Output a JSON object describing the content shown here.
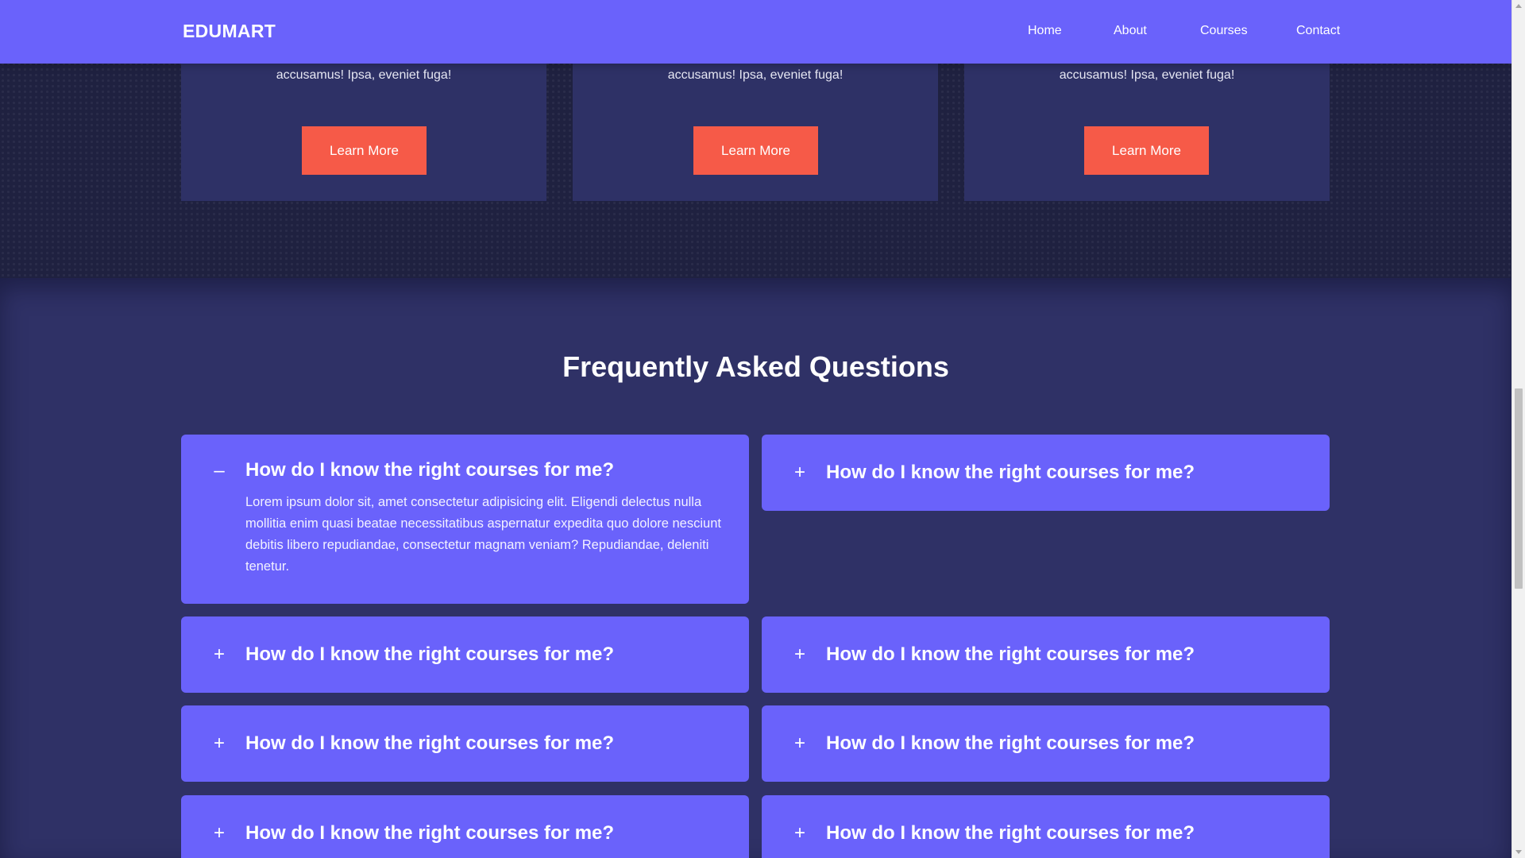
{
  "header": {
    "logo": "EDUMART",
    "nav": [
      "Home",
      "About",
      "Courses",
      "Contact"
    ]
  },
  "courses": {
    "cards": [
      {
        "desc": "accusamus! Ipsa, eveniet fuga!",
        "button": "Learn More"
      },
      {
        "desc": "accusamus! Ipsa, eveniet fuga!",
        "button": "Learn More"
      },
      {
        "desc": "accusamus! Ipsa, eveniet fuga!",
        "button": "Learn More"
      }
    ]
  },
  "faq": {
    "title": "Frequently Asked Questions",
    "items": [
      {
        "question": "How do I know the right courses for me?",
        "toggle": "–",
        "expanded": true,
        "answer": "Lorem ipsum dolor sit, amet consectetur adipisicing elit. Eligendi delectus nulla mollitia enim quasi beatae necessitatibus aspernatur expedita quo dolore nesciunt debitis libero repudiandae, consectetur magnam veniam? Repudiandae, deleniti tenetur."
      },
      {
        "question": "How do I know the right courses for me?",
        "toggle": "+",
        "expanded": false
      },
      {
        "question": "How do I know the right courses for me?",
        "toggle": "+",
        "expanded": false
      },
      {
        "question": "How do I know the right courses for me?",
        "toggle": "+",
        "expanded": false
      },
      {
        "question": "How do I know the right courses for me?",
        "toggle": "+",
        "expanded": false
      },
      {
        "question": "How do I know the right courses for me?",
        "toggle": "+",
        "expanded": false
      },
      {
        "question": "How do I know the right courses for me?",
        "toggle": "+",
        "expanded": false
      },
      {
        "question": "How do I know the right courses for me?",
        "toggle": "+",
        "expanded": false
      }
    ]
  },
  "colors": {
    "primary": "#6a62fb",
    "accent": "#f65a48",
    "card": "#2e3166",
    "section_bg": "#2f3166"
  }
}
